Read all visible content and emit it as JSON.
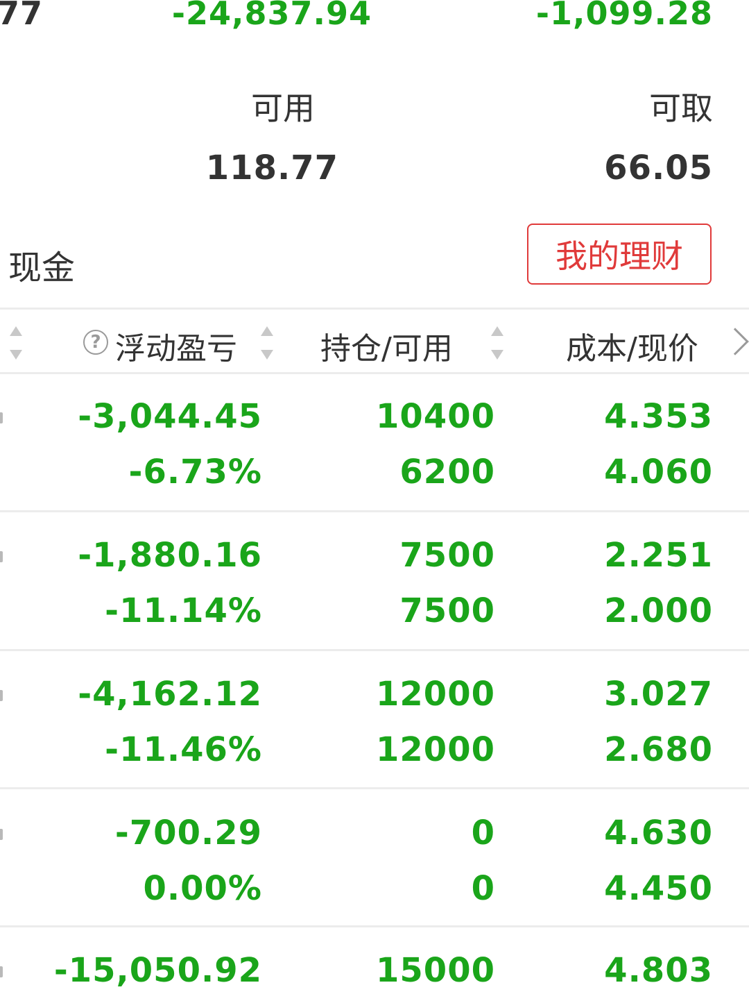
{
  "summary": {
    "top_left_value": "77",
    "top_mid_value": "-24,837.94",
    "top_right_value": "-1,099.28",
    "available_label": "可用",
    "withdrawable_label": "可取",
    "available_value": "118.77",
    "withdrawable_value": "66.05"
  },
  "cash": {
    "label": "现金",
    "wealth_button": "我的理财"
  },
  "table": {
    "headers": {
      "float_pl": "浮动盈亏",
      "position": "持仓/可用",
      "cost_price": "成本/现价"
    },
    "rows": [
      {
        "pl": "-3,044.45",
        "pl_pct": "-6.73%",
        "hold": "10400",
        "avail": "6200",
        "cost": "4.353",
        "price": "4.060"
      },
      {
        "pl": "-1,880.16",
        "pl_pct": "-11.14%",
        "hold": "7500",
        "avail": "7500",
        "cost": "2.251",
        "price": "2.000"
      },
      {
        "pl": "-4,162.12",
        "pl_pct": "-11.46%",
        "hold": "12000",
        "avail": "12000",
        "cost": "3.027",
        "price": "2.680"
      },
      {
        "pl": "-700.29",
        "pl_pct": "0.00%",
        "hold": "0",
        "avail": "0",
        "cost": "4.630",
        "price": "4.450"
      },
      {
        "pl": "-15,050.92",
        "hold": "15000",
        "cost": "4.803"
      }
    ]
  },
  "colors": {
    "loss": "#1aa51a",
    "accent": "#e03a3a",
    "text": "#333333"
  },
  "icons": [
    "help-circle-icon",
    "sort-icon",
    "chevron-right-icon"
  ]
}
